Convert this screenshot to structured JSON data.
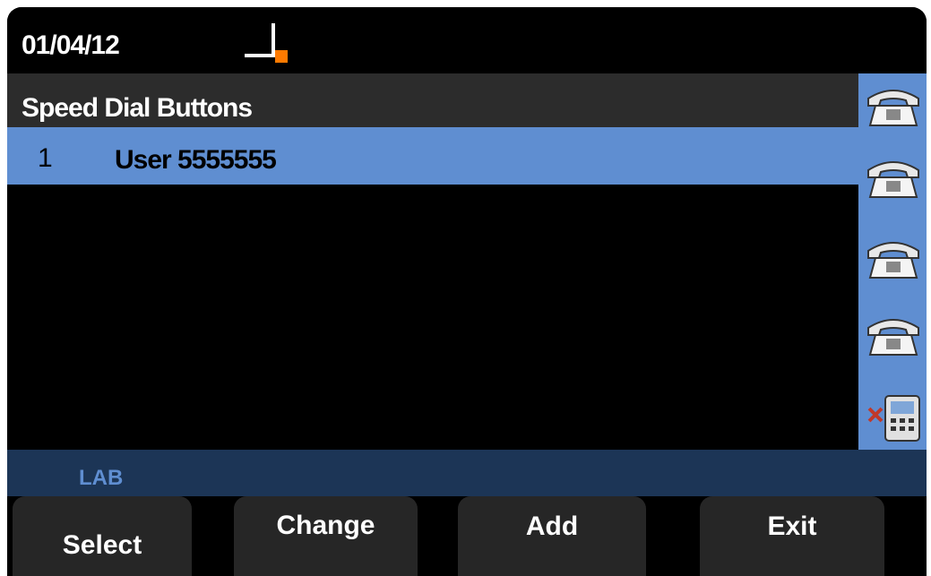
{
  "status": {
    "date": "01/04/12",
    "signal_icon": "signal-strength-icon"
  },
  "header": {
    "title": "Speed Dial Buttons"
  },
  "speed_dials": [
    {
      "index": "1",
      "name": "User 5555555"
    }
  ],
  "sidebar": {
    "line_keys": [
      "phone-line-icon",
      "phone-line-icon",
      "phone-line-icon",
      "phone-line-icon"
    ],
    "bottom_icon": "dnd-keypad-icon"
  },
  "footer": {
    "label": "LAB"
  },
  "softkeys": {
    "select": "Select",
    "change": "Change",
    "add": "Add",
    "exit": "Exit"
  },
  "colors": {
    "highlight": "#5f8ed1",
    "label_bar": "#1c3556",
    "title_bar": "#2c2c2c",
    "signal_accent": "#ff7a00"
  }
}
